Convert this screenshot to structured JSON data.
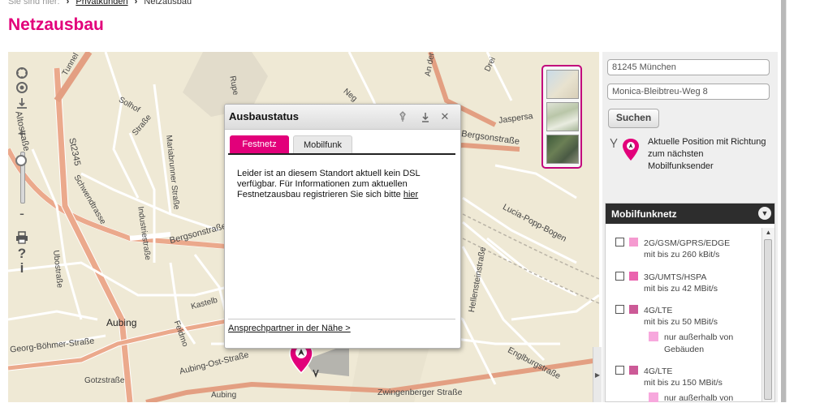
{
  "breadcrumb": {
    "prefix": "Sie sind hier:",
    "items": [
      "Privatkunden",
      "Netzausbau"
    ]
  },
  "page_title": "Netzausbau",
  "map": {
    "labels": {
      "tunnel": "Tunnel",
      "altostrasse": "Altostraße",
      "st2345": "St2345",
      "solhof": "Solhof",
      "strasse_frag": "Straße",
      "mariabrunner": "Mariabrunner Straße",
      "schwendtrasse": "Schwendtrasse",
      "industriestrasse": "Industriestraße",
      "bergsonstrasse_left": "Bergsonstraße",
      "bergsonstrasse_right": "Bergsonstraße",
      "ubostrasse": "Ubostraße",
      "aubing": "Aubing",
      "kastelb": "Kastelb",
      "feldmoching": "Feldmo",
      "georg": "Georg-Böhmer-Straße",
      "aubing_ost": "Aubing-Ost-Straße",
      "gotzstrasse": "Gotzstraße",
      "aubing_bottom": "Aubing",
      "zwingenberger": "Zwingenberger Straße",
      "englburg": "Englburgstraße",
      "hellenstein": "Hellensteinstraße",
      "lucia": "Lucia-Popp-Bogen",
      "jaspersa": "Jaspersa",
      "anderl": "An der",
      "drei": "Drei",
      "rupert": "Rupe",
      "neg": "Neg"
    },
    "layer_thumbs": [
      "map-layer-thumb",
      "terrain-layer-thumb",
      "satellite-layer-thumb"
    ]
  },
  "popup": {
    "title": "Ausbaustatus",
    "tabs": [
      "Festnetz",
      "Mobilfunk"
    ],
    "text": "Leider ist an diesem Standort aktuell kein DSL verfügbar. Für Informationen zum aktuellen Festnetzausbau registrieren Sie sich bitte",
    "link": "hier",
    "footer_link": "Ansprechpartner in der Nähe >"
  },
  "sidebar": {
    "city_value": "81245 München",
    "street_value": "Monica-Bleibtreu-Weg 8",
    "search_button": "Suchen",
    "position_text": "Aktuelle Position mit Richtung zum nächsten Mobilfunksender"
  },
  "legend": {
    "title": "Mobilfunknetz",
    "entries": [
      {
        "name": "2G/GSM/GPRS/EDGE",
        "speed": "mit bis zu 260 kBit/s"
      },
      {
        "name": "3G/UMTS/HSPA",
        "speed": "mit bis zu 42 MBit/s"
      },
      {
        "name": "4G/LTE",
        "speed": "mit bis zu 50 MBit/s",
        "sub": "nur außerhalb von Gebäuden"
      },
      {
        "name": "4G/LTE",
        "speed": "mit bis zu 150 MBit/s",
        "sub": "nur außerhalb von"
      }
    ]
  },
  "colors": {
    "brand": "#e2007a",
    "legend_2g": "#f59ad0",
    "legend_3g": "#ea63ae",
    "legend_4g": "#cc5a97",
    "legend_sub": "#f7a8dd",
    "major_road": "#eba98c",
    "minor_road": "#ffffff"
  }
}
